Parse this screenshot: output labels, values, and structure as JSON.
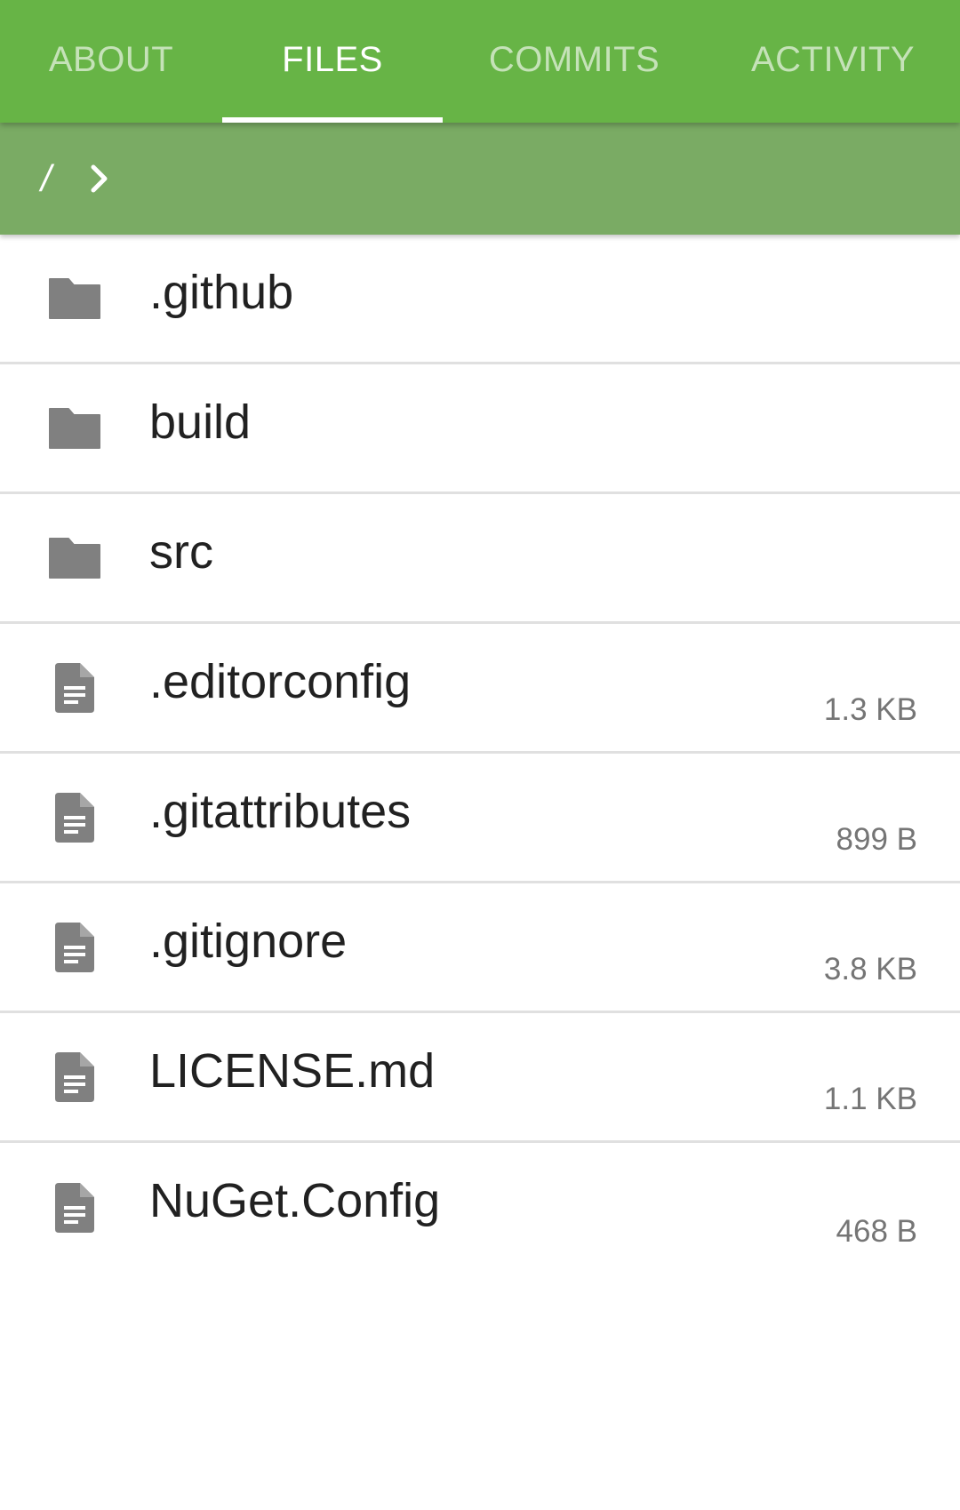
{
  "tabs": [
    {
      "label": "ABOUT",
      "active": false
    },
    {
      "label": "FILES",
      "active": true
    },
    {
      "label": "COMMITS",
      "active": false
    },
    {
      "label": "ACTIVITY",
      "active": false
    }
  ],
  "breadcrumb": {
    "root_label": "/",
    "separator_icon": "chevron-right-icon"
  },
  "files": [
    {
      "name": ".github",
      "type": "folder",
      "icon": "folder-icon",
      "size": ""
    },
    {
      "name": "build",
      "type": "folder",
      "icon": "folder-icon",
      "size": ""
    },
    {
      "name": "src",
      "type": "folder",
      "icon": "folder-icon",
      "size": ""
    },
    {
      "name": ".editorconfig",
      "type": "file",
      "icon": "file-icon",
      "size": "1.3 KB"
    },
    {
      "name": ".gitattributes",
      "type": "file",
      "icon": "file-icon",
      "size": "899 B"
    },
    {
      "name": ".gitignore",
      "type": "file",
      "icon": "file-icon",
      "size": "3.8 KB"
    },
    {
      "name": "LICENSE.md",
      "type": "file",
      "icon": "file-icon",
      "size": "1.1 KB"
    },
    {
      "name": "NuGet.Config",
      "type": "file",
      "icon": "file-icon",
      "size": "468 B"
    }
  ],
  "colors": {
    "tabbar_bg": "#67b446",
    "breadcrumb_bg": "#7aab64",
    "icon_gray": "#808080",
    "divider": "#e0e0e0"
  }
}
